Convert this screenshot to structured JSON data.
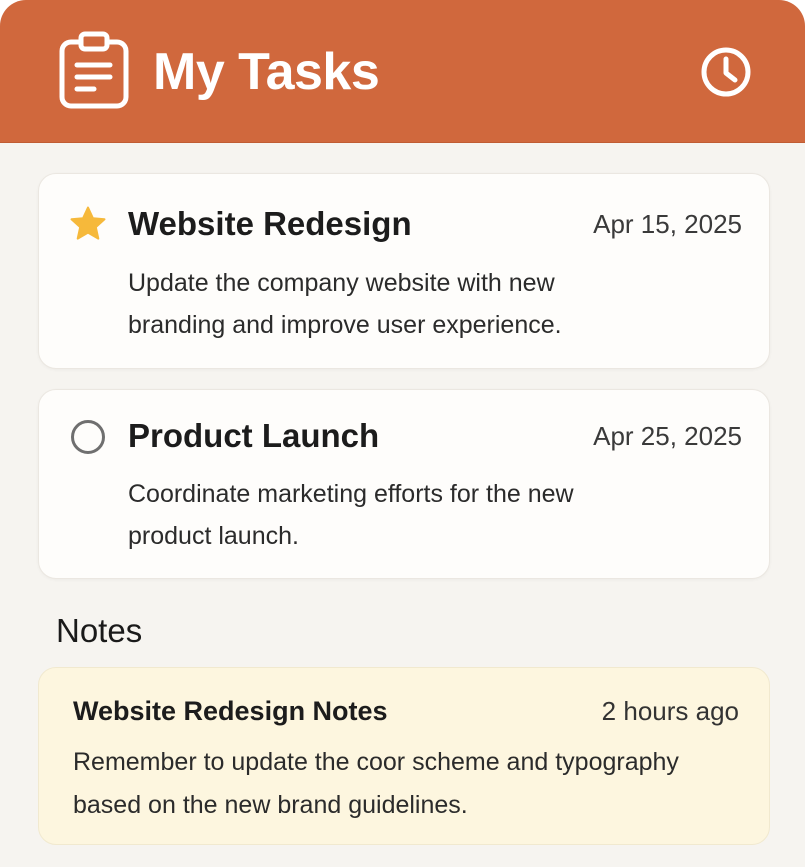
{
  "header": {
    "title": "My Tasks",
    "app_icon": "clipboard-icon",
    "action_icon": "clock-icon"
  },
  "tasks": [
    {
      "title": "Website Redesign",
      "date": "Apr 15, 2025",
      "description": "Update the company website with new branding and improve user experience.",
      "status_icon": "star-icon",
      "starred": true
    },
    {
      "title": "Product Launch",
      "date": "Apr 25, 2025",
      "description": "Coordinate marketing  efforts for the new product launch.",
      "status_icon": "circle-icon",
      "starred": false
    }
  ],
  "notes": {
    "heading": "Notes",
    "items": [
      {
        "title": "Website Redesign Notes",
        "time": "2 hours ago",
        "body": "Remember to update the coor scheme and typography based on the new brand guidelines."
      }
    ]
  },
  "colors": {
    "header_bg": "#d0683d",
    "app_bg": "#f6f4f0",
    "card_bg": "#fefdfb",
    "note_bg": "#fdf6df",
    "star": "#f6b93b",
    "circle": "#6f6f6f"
  }
}
